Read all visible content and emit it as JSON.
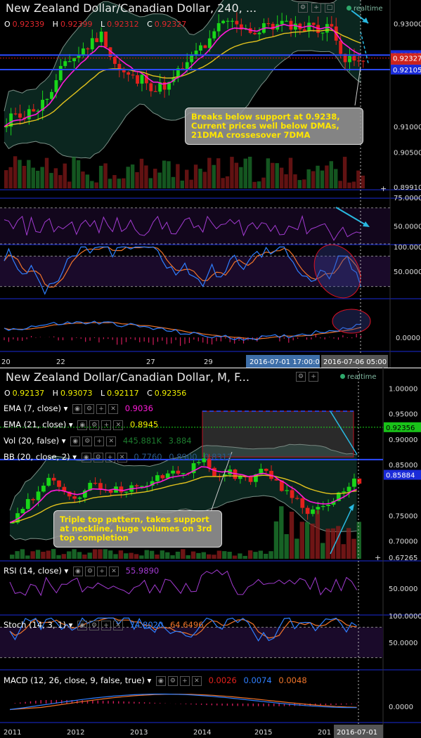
{
  "colors": {
    "up": "#19d619",
    "down": "#e3211c",
    "bb": "#7a8f86",
    "ema7": "#ff1ad9",
    "ema21": "#e2c21d",
    "blue_line": "#2b4bff",
    "rsi": "#a23bd1",
    "stoch_k": "#2f7fff",
    "stoch_d": "#f0742a",
    "macd": "#2f7fff",
    "signal": "#f0742a",
    "hist": "#d11b5a",
    "accent": "#2f80ff",
    "vol": "#1d7a2e",
    "volRed": "#8a1a1a",
    "note": "#ffe600"
  },
  "chart1": {
    "title": "New Zealand Dollar/Canadian Dollar, 240, ...",
    "ohlc": {
      "o": "0.92339",
      "h": "0.92399",
      "l": "0.92312",
      "c": "0.92327"
    },
    "realtime": "realtime",
    "price_labels": [
      "0.93000",
      "0.92385",
      "0.92327",
      "3:26:22",
      "0.92105",
      "0.91000",
      "0.90500",
      "0.89910"
    ],
    "rsi_labels": [
      "75.0000",
      "50.0000"
    ],
    "stoch_labels": [
      "100.0000",
      "50.0000"
    ],
    "macd_labels": [
      "0.0000"
    ],
    "x_labels": [
      "20",
      "22",
      "27",
      "29",
      "2016-07-01  17:00:0",
      "2016-07-06  05:00"
    ],
    "note": "Breaks below support at 0.9238, Current prices well below DMAs, 21DMA crossesover 7DMA"
  },
  "chart2": {
    "title": "New Zealand Dollar/Canadian Dollar, M, F...",
    "ohlc": {
      "o": "0.92137",
      "h": "0.93073",
      "l": "0.92117",
      "c": "0.92356"
    },
    "realtime": "realtime",
    "ema7": {
      "label": "EMA (7, close)",
      "value": "0.9036"
    },
    "ema21": {
      "label": "EMA (21, close)",
      "value": "0.8945"
    },
    "vol": {
      "label": "Vol (20, false)",
      "value": "445.881K",
      "value2": "3.884"
    },
    "bb": {
      "label": "BB (20, close, 2)",
      "value": "0.7760",
      "value2": "0.8900",
      "value3": "0.8312"
    },
    "rsi": {
      "label": "RSI (14, close)",
      "value": "55.9890"
    },
    "stoch": {
      "label": "Stoch (14, 3, 1)",
      "k": "74.8020",
      "d": "64.6496"
    },
    "macd": {
      "label": "MACD (12, 26, close, 9, false, true)",
      "v1": "0.0026",
      "v2": "0.0074",
      "v3": "0.0048"
    },
    "price_labels": [
      "1.00000",
      "0.95000",
      "0.92356",
      "0.90000",
      "0.85000",
      "0.85884",
      "0.75000",
      "0.70000",
      "0.67265"
    ],
    "rsi_labels": [
      "50.0000"
    ],
    "stoch_labels": [
      "100.0000",
      "50.0000"
    ],
    "macd_labels": [
      "0.0000"
    ],
    "x_labels": [
      "2011",
      "2012",
      "2013",
      "2014",
      "2015",
      "201",
      "2016-07-01"
    ],
    "note": "Triple top pattern, takes support at neckline, huge volumes on 3rd top completion"
  }
}
